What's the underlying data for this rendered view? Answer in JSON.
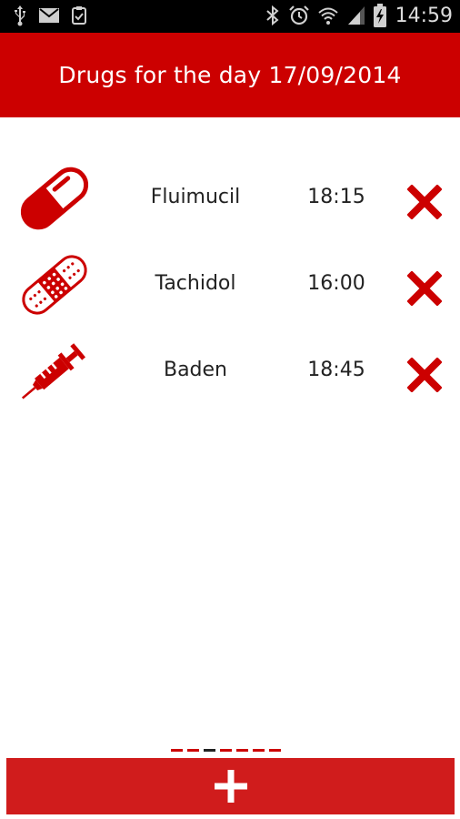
{
  "status_bar": {
    "time": "14:59",
    "icons": [
      "usb-icon",
      "mail-icon",
      "clipboard-check-icon",
      "bluetooth-icon",
      "alarm-icon",
      "wifi-icon",
      "signal-icon",
      "battery-charging-icon"
    ]
  },
  "header": {
    "title": "Drugs for the day 17/09/2014"
  },
  "drugs": [
    {
      "name": "Fluimucil",
      "time": "18:15",
      "icon": "capsule-icon"
    },
    {
      "name": "Tachidol",
      "time": "16:00",
      "icon": "bandage-icon"
    },
    {
      "name": "Baden",
      "time": "18:45",
      "icon": "syringe-icon"
    }
  ],
  "pager": {
    "count": 7,
    "active_index": 2
  },
  "add_button": {
    "icon": "plus-icon"
  },
  "colors": {
    "brand_red": "#cc0000",
    "button_red": "#d01c1c",
    "status_bar": "#000000"
  }
}
